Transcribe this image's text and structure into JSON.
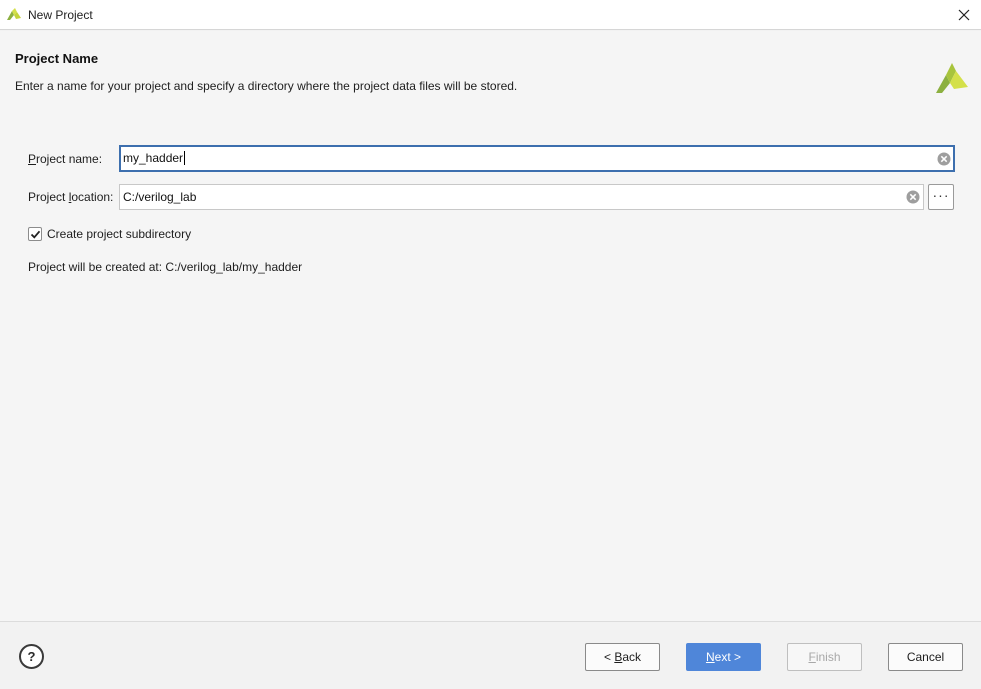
{
  "window": {
    "title": "New Project",
    "app_icon": "vivado-logo-icon",
    "close_icon": "close-icon"
  },
  "header": {
    "heading": "Project Name",
    "subtitle": "Enter a name for your project and specify a directory where the project data files will be stored.",
    "logo_icon": "vivado-logo-icon"
  },
  "form": {
    "project_name": {
      "label_prefix": "",
      "label_mnemonic": "P",
      "label_rest": "roject name:",
      "value": "my_hadder",
      "clear_icon": "clear-circle-icon"
    },
    "project_location": {
      "label_prefix": "Project ",
      "label_mnemonic": "l",
      "label_rest": "ocation:",
      "value": "C:/verilog_lab",
      "clear_icon": "clear-circle-icon",
      "browse_label": "···"
    },
    "create_subdirectory": {
      "label": "Create project subdirectory",
      "checked": true
    },
    "created_at": {
      "label": "Project will be created at:",
      "path": "C:/verilog_lab/my_hadder"
    }
  },
  "footer": {
    "help_label": "?",
    "back": {
      "prefix": "< ",
      "mnemonic": "B",
      "rest": "ack"
    },
    "next": {
      "prefix": "",
      "mnemonic": "N",
      "rest": "ext >"
    },
    "finish": {
      "prefix": "",
      "mnemonic": "F",
      "rest": "inish"
    },
    "cancel": "Cancel"
  },
  "colors": {
    "accent": "#4f86d9",
    "focus_border": "#3d6fae",
    "logo_green": "#8cb040",
    "logo_yellow": "#d4e04a"
  }
}
